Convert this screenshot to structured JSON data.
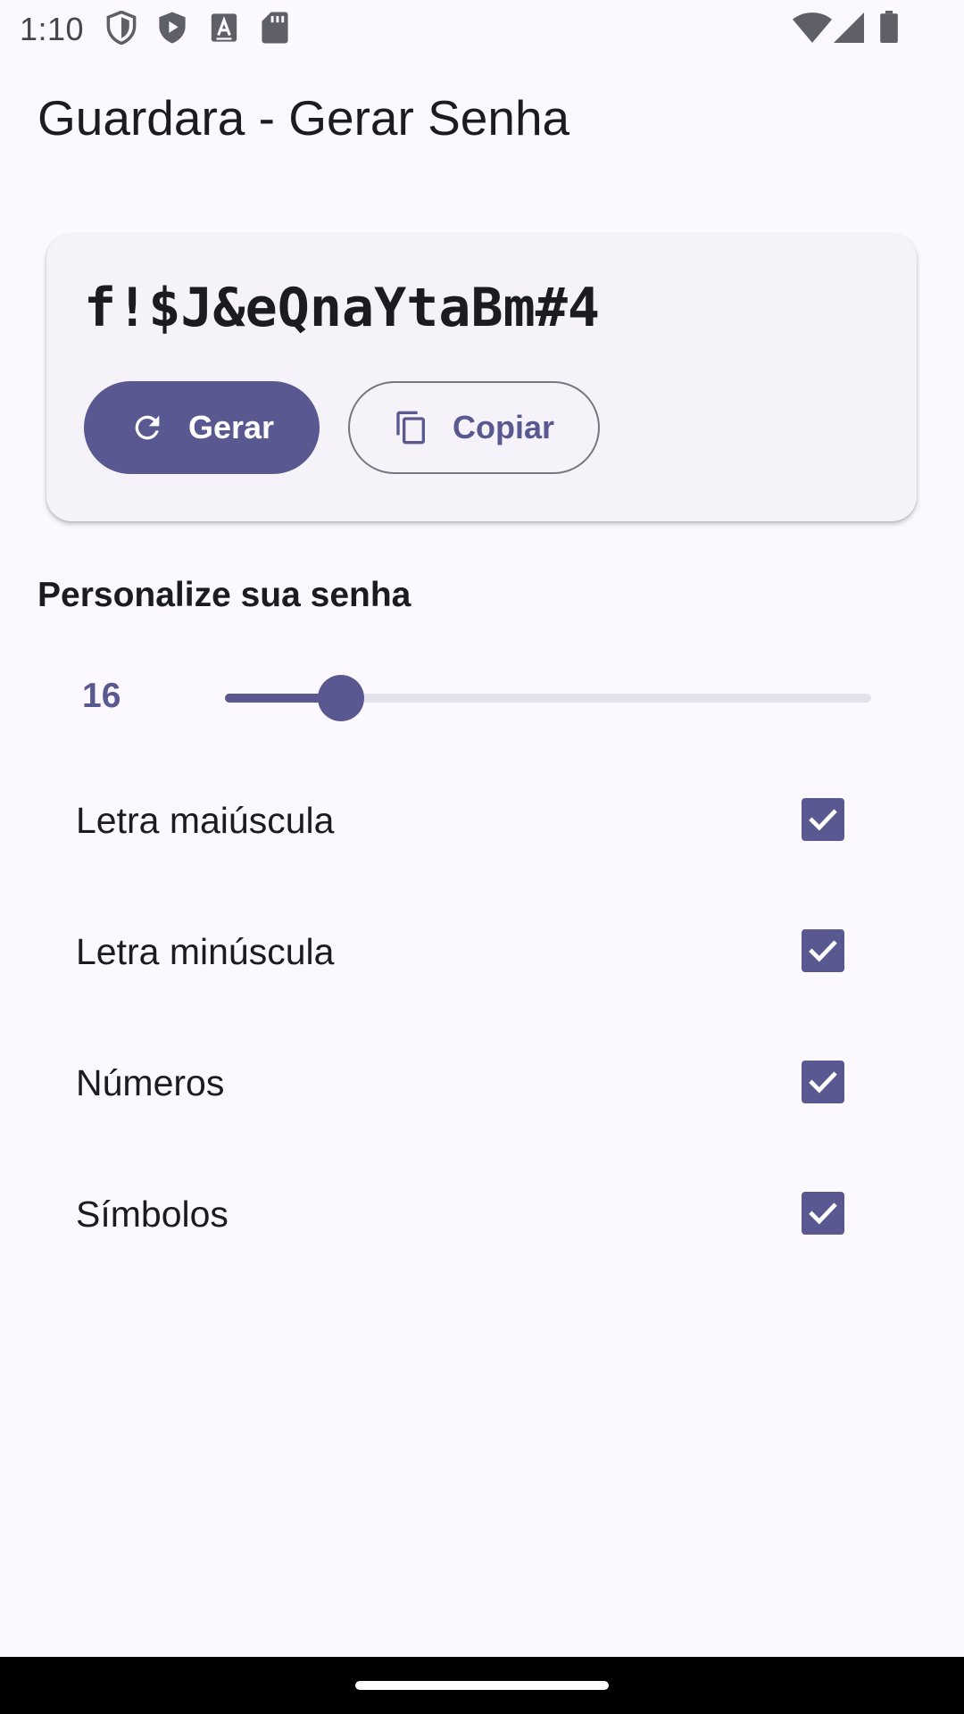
{
  "status_bar": {
    "time": "1:10",
    "left_icons": [
      "shield-icon",
      "play-protect-icon",
      "text-a-icon",
      "sd-card-icon"
    ],
    "right_icons": [
      "wifi-icon",
      "cellular-signal-icon",
      "battery-icon"
    ]
  },
  "app_bar": {
    "title": "Guardara - Gerar Senha"
  },
  "password_card": {
    "password": "f!$J&eQnaYtaBm#4",
    "generate_label": "Gerar",
    "generate_icon": "refresh-icon",
    "copy_label": "Copiar",
    "copy_icon": "copy-icon"
  },
  "customize": {
    "title": "Personalize sua senha",
    "length_value": "16",
    "length_fraction": 0.18,
    "options": [
      {
        "label": "Letra maiúscula",
        "checked": true
      },
      {
        "label": "Letra minúscula",
        "checked": true
      },
      {
        "label": "Números",
        "checked": true
      },
      {
        "label": "Símbolos",
        "checked": true
      }
    ]
  },
  "colors": {
    "primary": "#5a5891",
    "background": "#fcf8ff",
    "card": "#f5f2fa",
    "track": "#e4e1ec"
  }
}
